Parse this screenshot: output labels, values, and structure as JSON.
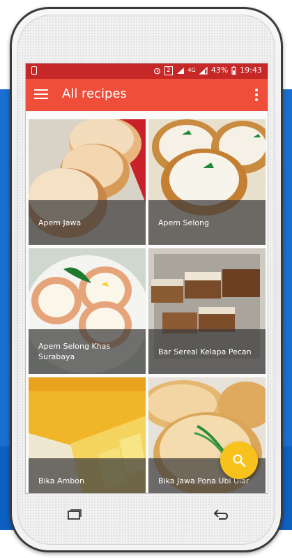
{
  "status_bar": {
    "network": "4G",
    "battery_percent": "43%",
    "time": "19:43",
    "icons": [
      "phone-icon",
      "alarm-icon",
      "sim-icon",
      "signal-icon",
      "battery-icon"
    ]
  },
  "app_bar": {
    "title": "All recipes",
    "menu_icon": "hamburger-menu-icon",
    "overflow_icon": "more-vert-icon"
  },
  "recipes": [
    {
      "name": "Apem Jawa"
    },
    {
      "name": "Apem Selong"
    },
    {
      "name": "Apem Selong Khas Surabaya"
    },
    {
      "name": "Bar Sereal Kelapa Pecan"
    },
    {
      "name": "Bika Ambon"
    },
    {
      "name": "Bika Jawa Pona Ubi Ular"
    }
  ],
  "fab": {
    "icon": "search-icon"
  },
  "nav_buttons": [
    "recent-apps-icon",
    "back-icon"
  ],
  "colors": {
    "status_bar": "#c62828",
    "app_bar": "#ef4e3a",
    "fab": "#f7c21b",
    "background_band": "#1a6fd0"
  }
}
